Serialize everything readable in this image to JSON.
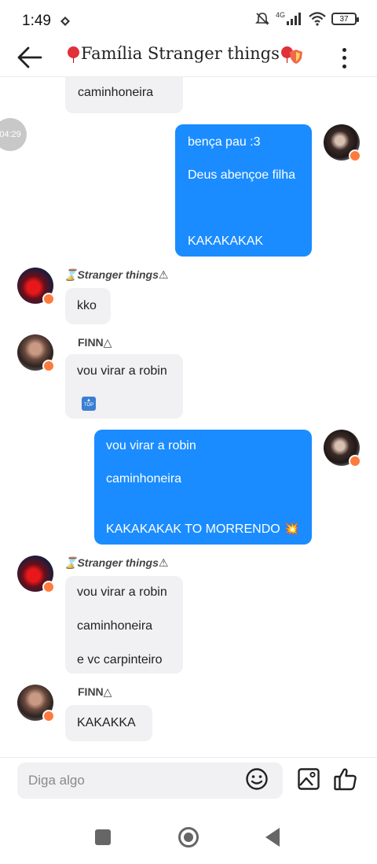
{
  "status_bar": {
    "time": "1:49",
    "network": "4G",
    "battery": "37"
  },
  "header": {
    "title": "Família Stranger things"
  },
  "chat": {
    "time_marker": "04:29",
    "messages": [
      {
        "direction": "in",
        "lines": [
          "caminhoneira"
        ]
      },
      {
        "direction": "out",
        "lines": [
          "bença pau :3",
          "Deus abençoe filha",
          "",
          "KAKAKAKAK"
        ]
      },
      {
        "direction": "in",
        "sender": "Stranger things",
        "lines": [
          "kko"
        ]
      },
      {
        "direction": "in",
        "sender": "FINN",
        "lines": [
          "vou virar a robin",
          "🔝"
        ]
      },
      {
        "direction": "out",
        "lines": [
          "vou virar a robin",
          "caminhoneira",
          "",
          "KAKAKAKAK TO MORRENDO 💥"
        ]
      },
      {
        "direction": "in",
        "sender": "Stranger things",
        "lines": [
          "vou virar a robin",
          "caminhoneira",
          "e vc carpinteiro"
        ]
      },
      {
        "direction": "in",
        "sender": "FINN",
        "lines": [
          "KAKAKKA"
        ]
      }
    ]
  },
  "input": {
    "placeholder": "Diga algo"
  },
  "icons": {
    "back": "back-arrow-icon",
    "more": "more-vertical-icon",
    "emoji": "emoji-icon",
    "image": "image-icon",
    "like": "thumbs-up-icon"
  },
  "colors": {
    "outgoing_bubble": "#1a8cff",
    "incoming_bubble": "#f1f0f3",
    "avatar_badge": "#ff7a3c"
  }
}
